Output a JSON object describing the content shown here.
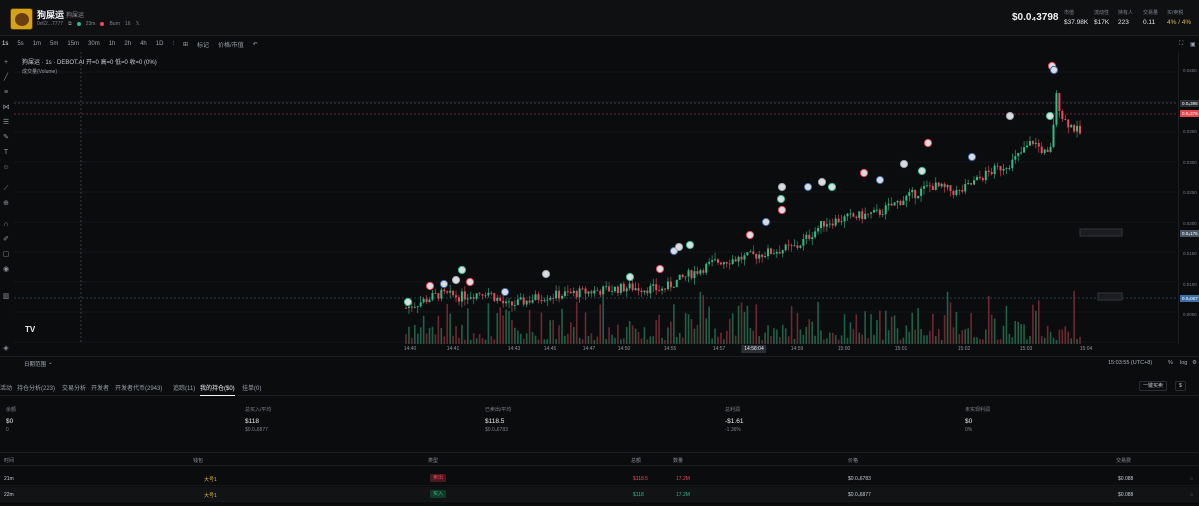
{
  "header": {
    "token_name": "狗屎运",
    "token_sub": "狗屎运",
    "address": "0x62...7777",
    "age": "23m",
    "status": "Burn",
    "tax": "16",
    "price": "$0.0₄3798",
    "stats": [
      {
        "label": "市值",
        "value": "$37.98K"
      },
      {
        "label": "流动性",
        "value": "$17K"
      },
      {
        "label": "持有人",
        "value": "223"
      },
      {
        "label": "交易量",
        "value": "0.11"
      },
      {
        "label": "买/卖税",
        "value": "4% / 4%"
      }
    ]
  },
  "toolbar": {
    "intervals": [
      "1s",
      "5s",
      "1m",
      "5m",
      "15m",
      "30m",
      "1h",
      "2h",
      "4h",
      "1D"
    ],
    "active_interval": "1s",
    "mark_label": "标记",
    "price_label": "价格/市值"
  },
  "chart_meta": {
    "legend": "狗屎运 · 1s · DEBOT.AI  开=0  高=0  低=0  收=0  (0%)",
    "volume_legend": "成交量(Volume)",
    "range_label": "日期范围",
    "crosshair_time": "14:58:04",
    "footer_time": "15:03:55 (UTC+8)",
    "log_label": "log",
    "pct_label": "%",
    "scale_label": "auto"
  },
  "chart_data": {
    "type": "candlestick",
    "x_ticks": [
      "14:40",
      "14:41",
      "14:43",
      "14:45",
      "14:47",
      "14:50",
      "14:55",
      "14:57",
      "14:58:04",
      "14:59",
      "15:00",
      "15:01",
      "15:02",
      "15:03",
      "15:04"
    ],
    "y_ticks": [
      "0.0450",
      "0.0400",
      "0.0350",
      "0.0300",
      "0.0250",
      "0.0200",
      "0.0150",
      "0.0100",
      "0.0050"
    ],
    "price_tags": [
      {
        "label": "0.0₄398",
        "color": "#2a2d33"
      },
      {
        "label": "0.0₄379",
        "color": "#e5484d"
      },
      {
        "label": "0.0₄175",
        "color": "#4a5568"
      },
      {
        "label": "0.0₄067",
        "color": "#3d6ea8"
      }
    ],
    "ylim": [
      0.0,
      0.05
    ],
    "trend": [
      {
        "t": 0.0,
        "p": 0.0065
      },
      {
        "t": 0.05,
        "p": 0.009
      },
      {
        "t": 0.08,
        "p": 0.0085
      },
      {
        "t": 0.12,
        "p": 0.0095
      },
      {
        "t": 0.15,
        "p": 0.0068
      },
      {
        "t": 0.2,
        "p": 0.0085
      },
      {
        "t": 0.28,
        "p": 0.0095
      },
      {
        "t": 0.33,
        "p": 0.0102
      },
      {
        "t": 0.38,
        "p": 0.0098
      },
      {
        "t": 0.42,
        "p": 0.0125
      },
      {
        "t": 0.46,
        "p": 0.0148
      },
      {
        "t": 0.5,
        "p": 0.0155
      },
      {
        "t": 0.55,
        "p": 0.0168
      },
      {
        "t": 0.58,
        "p": 0.0175
      },
      {
        "t": 0.62,
        "p": 0.0218
      },
      {
        "t": 0.66,
        "p": 0.0228
      },
      {
        "t": 0.7,
        "p": 0.0235
      },
      {
        "t": 0.74,
        "p": 0.0262
      },
      {
        "t": 0.78,
        "p": 0.0285
      },
      {
        "t": 0.82,
        "p": 0.0272
      },
      {
        "t": 0.86,
        "p": 0.0305
      },
      {
        "t": 0.9,
        "p": 0.0328
      },
      {
        "t": 0.93,
        "p": 0.0365
      },
      {
        "t": 0.955,
        "p": 0.0335
      },
      {
        "t": 0.965,
        "p": 0.0445
      },
      {
        "t": 0.975,
        "p": 0.0405
      },
      {
        "t": 1.0,
        "p": 0.0379
      }
    ]
  },
  "bottom_tabs": {
    "tabs": [
      "活动",
      "持仓分析(223)",
      "交易分析",
      "开发者",
      "开发者代币(2943)",
      "追踪(11)",
      "我的持仓($0)",
      "挂单(0)"
    ],
    "active": "我的持仓($0)",
    "action_label": "一键买卖",
    "action2_label": "$"
  },
  "summary": [
    {
      "label": "余额",
      "value": "$0",
      "sub": "0"
    },
    {
      "label": "总买入/平均",
      "value": "$118",
      "sub": "$0.0₄6877"
    },
    {
      "label": "已卖出/平均",
      "value": "$118.5",
      "sub": "$0.0₄6783"
    },
    {
      "label": "总利润",
      "value": "-$1.61",
      "sub": "-1.36%"
    },
    {
      "label": "未实现利润",
      "value": "$0",
      "sub": "0%"
    }
  ],
  "table": {
    "headers": [
      "时间",
      "钱包",
      "类型",
      "总额",
      "数量",
      "价格",
      "交易费"
    ],
    "rows": [
      {
        "time": "21m",
        "wallet": "大号1",
        "type": "卖出",
        "amount": "$118.5",
        "qty": "17.2M",
        "price": "$0.0₄6783",
        "fee": "$0.088"
      },
      {
        "time": "22m",
        "wallet": "大号1",
        "type": "买入",
        "amount": "$118",
        "qty": "17.2M",
        "price": "$0.0₄6877",
        "fee": "$0.088"
      }
    ]
  }
}
